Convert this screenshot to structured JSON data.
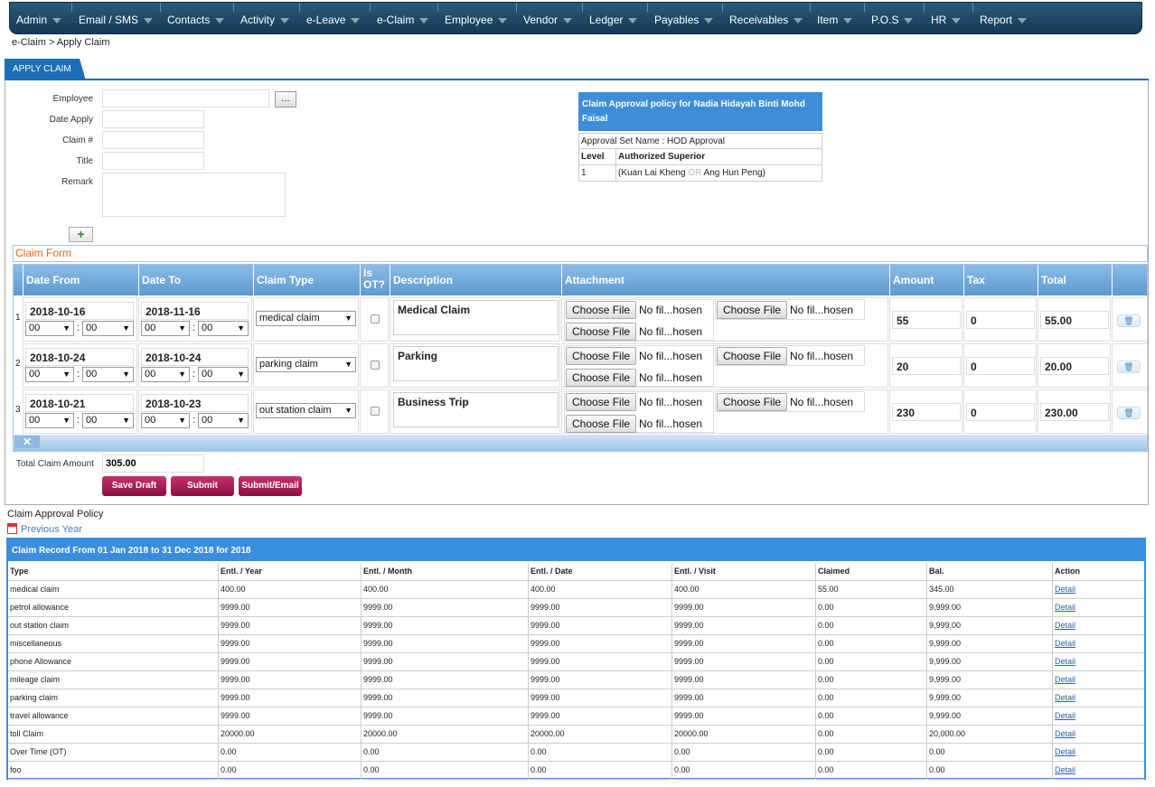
{
  "nav": [
    {
      "label": "Admin"
    },
    {
      "label": "Email / SMS"
    },
    {
      "label": "Contacts"
    },
    {
      "label": "Activity"
    },
    {
      "label": "e-Leave"
    },
    {
      "label": "e-Claim"
    },
    {
      "label": "Employee"
    },
    {
      "label": "Vendor"
    },
    {
      "label": "Ledger"
    },
    {
      "label": "Payables"
    },
    {
      "label": "Receivables"
    },
    {
      "label": "Item"
    },
    {
      "label": "P.O.S"
    },
    {
      "label": "HR"
    },
    {
      "label": "Report"
    }
  ],
  "breadcrumb": "e-Claim > Apply Claim",
  "tab": "APPLY CLAIM",
  "form": {
    "employee_label": "Employee",
    "employee_value": "",
    "browse_label": "...",
    "date_apply_label": "Date Apply",
    "date_apply_value": "",
    "claim_no_label": "Claim #",
    "claim_no_value": "",
    "title_label": "Title",
    "title_value": "",
    "remark_label": "Remark",
    "remark_value": "",
    "add_label": "+"
  },
  "policy": {
    "header": "Claim Approval policy for Nadia Hidayah Binti Mohd Faisal",
    "set_name": "Approval Set Name : HOD Approval",
    "col_level": "Level",
    "col_superior": "Authorized Superior",
    "rows": [
      {
        "level": "1",
        "sup1": "(Kuan Lai Kheng",
        "or": "OR",
        "sup2": "Ang Hun Peng)"
      }
    ]
  },
  "claim_form": {
    "title": "Claim Form",
    "headers": {
      "date_from": "Date From",
      "date_to": "Date To",
      "claim_type": "Claim Type",
      "is_ot": "Is OT?",
      "description": "Description",
      "attachment": "Attachment",
      "amount": "Amount",
      "tax": "Tax",
      "total": "Total"
    },
    "file_btn": "Choose File",
    "file_none": "No fil...hosen",
    "trash_icon": "🗑",
    "rows": [
      {
        "n": "1",
        "date_from": "2018-10-16",
        "from_h": "00",
        "from_m": "00",
        "date_to": "2018-11-16",
        "to_h": "00",
        "to_m": "00",
        "claim_type": "medical claim",
        "description": "Medical Claim",
        "amount": "55",
        "tax": "0",
        "total": "55.00"
      },
      {
        "n": "2",
        "date_from": "2018-10-24",
        "from_h": "00",
        "from_m": "00",
        "date_to": "2018-10-24",
        "to_h": "00",
        "to_m": "00",
        "claim_type": "parking claim",
        "description": "Parking",
        "amount": "20",
        "tax": "0",
        "total": "20.00"
      },
      {
        "n": "3",
        "date_from": "2018-10-21",
        "from_h": "00",
        "from_m": "00",
        "date_to": "2018-10-23",
        "to_h": "00",
        "to_m": "00",
        "claim_type": "out station claim",
        "description": "Business Trip",
        "amount": "230",
        "tax": "0",
        "total": "230.00"
      }
    ],
    "close_label": "✕",
    "total_label": "Total Claim Amount",
    "total_value": "305.00",
    "save_draft": "Save Draft",
    "submit": "Submit",
    "submit_email": "Submit/Email"
  },
  "approval_policy_label": "Claim Approval Policy",
  "previous_year": "Previous Year",
  "record": {
    "title": "Claim Record From 01 Jan 2018 to 31 Dec 2018 for 2018",
    "headers": [
      "Type",
      "Entl. / Year",
      "Entl. / Month",
      "Entl. / Date",
      "Entl. / Visit",
      "Claimed",
      "Bal.",
      "Action"
    ],
    "detail": "Detail",
    "rows": [
      [
        "medical claim",
        "400.00",
        "400.00",
        "400.00",
        "400.00",
        "55.00",
        "345.00"
      ],
      [
        "petrol allowance",
        "9999.00",
        "9999.00",
        "9999.00",
        "9999.00",
        "0.00",
        "9,999.00"
      ],
      [
        "out station claim",
        "9999.00",
        "9999.00",
        "9999.00",
        "9999.00",
        "0.00",
        "9,999.00"
      ],
      [
        "miscellaneous",
        "9999.00",
        "9999.00",
        "9999.00",
        "9999.00",
        "0.00",
        "9,999.00"
      ],
      [
        "phone Allowance",
        "9999.00",
        "9999.00",
        "9999.00",
        "9999.00",
        "0.00",
        "9,999.00"
      ],
      [
        "mileage claim",
        "9999.00",
        "9999.00",
        "9999.00",
        "9999.00",
        "0.00",
        "9,999.00"
      ],
      [
        "parking claim",
        "9999.00",
        "9999.00",
        "9999.00",
        "9999.00",
        "0.00",
        "9,999.00"
      ],
      [
        "travel allowance",
        "9999.00",
        "9999.00",
        "9999.00",
        "9999.00",
        "0.00",
        "9,999.00"
      ],
      [
        "toll Claim",
        "20000.00",
        "20000.00",
        "20000.00",
        "20000.00",
        "0.00",
        "20,000.00"
      ],
      [
        "Over Time (OT)",
        "0.00",
        "0.00",
        "0.00",
        "0.00",
        "0.00",
        "0.00"
      ],
      [
        "foo",
        "0.00",
        "0.00",
        "0.00",
        "0.00",
        "0.00",
        "0.00"
      ]
    ]
  }
}
